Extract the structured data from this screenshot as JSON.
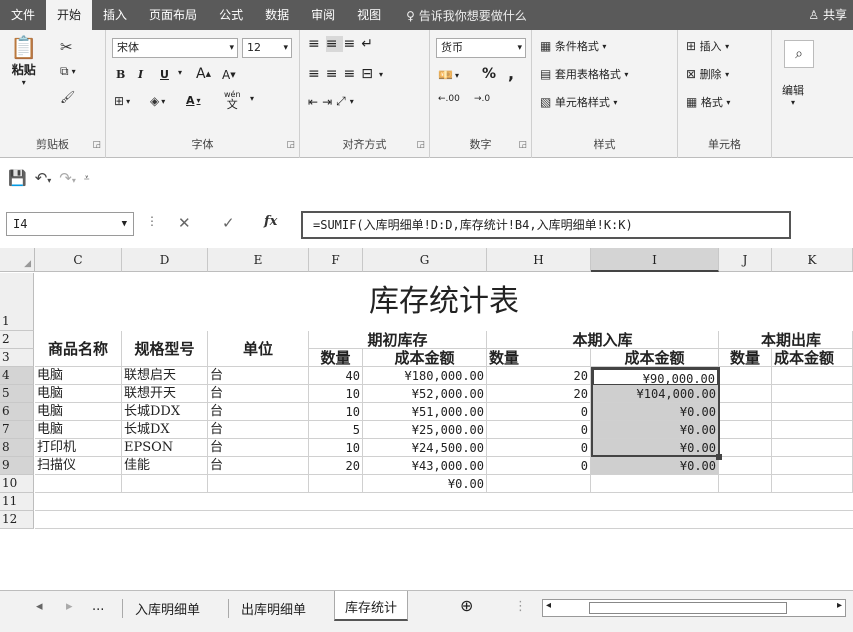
{
  "ribbon_tabs": [
    "文件",
    "开始",
    "插入",
    "页面布局",
    "公式",
    "数据",
    "审阅",
    "视图"
  ],
  "active_tab": "开始",
  "tell_me": "告诉我你想要做什么",
  "share": "共享",
  "clipboard": {
    "paste": "粘贴",
    "label": "剪贴板"
  },
  "font": {
    "name": "宋体",
    "size": "12",
    "bold": "B",
    "italic": "I",
    "underline": "U",
    "grow": "A",
    "shrink": "A",
    "color": "A",
    "phonetic": "wén",
    "phonetic_char": "文",
    "label": "字体"
  },
  "alignment": {
    "label": "对齐方式"
  },
  "number": {
    "format": "货币",
    "percent": "%",
    "comma": ",",
    "inc": ".00",
    "dec": ".0",
    "label": "数字"
  },
  "styles": {
    "cond": "条件格式",
    "table": "套用表格格式",
    "cell": "单元格样式",
    "label": "样式"
  },
  "cells": {
    "insert": "插入",
    "delete": "删除",
    "format": "格式",
    "label": "单元格"
  },
  "editing": {
    "label": "编辑"
  },
  "namebox": "I4",
  "formula": "=SUMIF(入库明细单!D:D,库存统计!B4,入库明细单!K:K)",
  "columns": [
    "C",
    "D",
    "E",
    "F",
    "G",
    "H",
    "I",
    "J",
    "K"
  ],
  "rows": [
    "1",
    "2",
    "3",
    "4",
    "5",
    "6",
    "7",
    "8",
    "9",
    "10",
    "11",
    "12"
  ],
  "title": "库存统计表",
  "headers": {
    "name": "商品名称",
    "spec": "规格型号",
    "unit": "单位",
    "opening": "期初库存",
    "incoming": "本期入库",
    "outgoing": "本期出库",
    "qty": "数量",
    "cost": "成本金额"
  },
  "data_rows": [
    {
      "name": "电脑",
      "spec": "联想启天",
      "unit": "台",
      "open_qty": "40",
      "open_cost": "¥180,000.00",
      "in_qty": "20",
      "in_cost": "¥90,000.00"
    },
    {
      "name": "电脑",
      "spec": "联想开天",
      "unit": "台",
      "open_qty": "10",
      "open_cost": "¥52,000.00",
      "in_qty": "20",
      "in_cost": "¥104,000.00"
    },
    {
      "name": "电脑",
      "spec": "长城DDX",
      "unit": "台",
      "open_qty": "10",
      "open_cost": "¥51,000.00",
      "in_qty": "0",
      "in_cost": "¥0.00"
    },
    {
      "name": "电脑",
      "spec": "长城DX",
      "unit": "台",
      "open_qty": "5",
      "open_cost": "¥25,000.00",
      "in_qty": "0",
      "in_cost": "¥0.00"
    },
    {
      "name": "打印机",
      "spec": "EPSON",
      "unit": "台",
      "open_qty": "10",
      "open_cost": "¥24,500.00",
      "in_qty": "0",
      "in_cost": "¥0.00"
    },
    {
      "name": "扫描仪",
      "spec": "佳能",
      "unit": "台",
      "open_qty": "20",
      "open_cost": "¥43,000.00",
      "in_qty": "0",
      "in_cost": "¥0.00"
    }
  ],
  "row10_g": "¥0.00",
  "sheet_tabs": [
    "入库明细单",
    "出库明细单",
    "库存统计"
  ],
  "active_sheet": "库存统计",
  "sheet_more": "..."
}
